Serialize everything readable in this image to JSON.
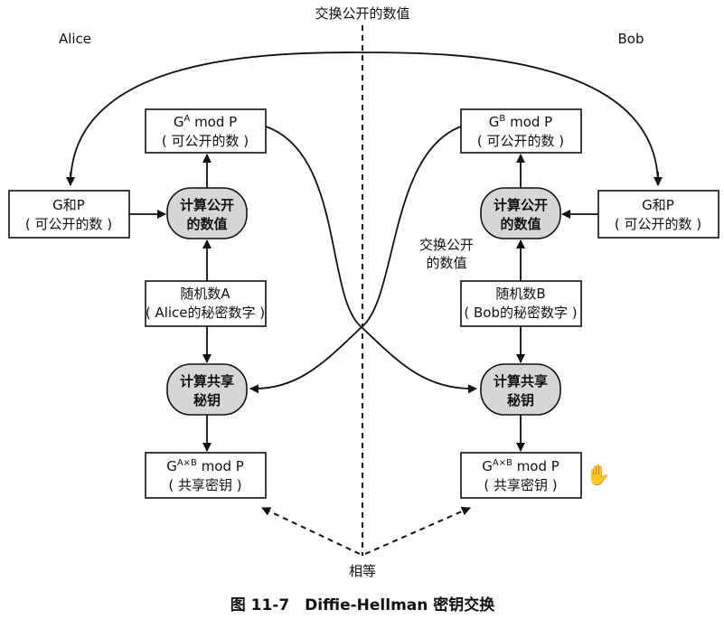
{
  "center_label": "交换公开的数值",
  "alice_label": "Alice",
  "bob_label": "Bob",
  "mid_exchange_label": [
    "交换公开",
    "的数值"
  ],
  "equal_label": "相等",
  "caption": "图 11-7　Diffie-Hellman 密钥交换",
  "alice": {
    "public_result": [
      "mod P",
      "( 可公开的数 )"
    ],
    "public_exp": "A",
    "gp": [
      "G和P",
      "( 可公开的数 )"
    ],
    "compute_public": [
      "计算公开",
      "的数值"
    ],
    "secret": [
      "随机数A",
      "( Alice的秘密数字 )"
    ],
    "compute_shared": [
      "计算共享",
      "秘钥"
    ],
    "shared_result": [
      "mod P",
      "( 共享密钥 )"
    ],
    "shared_exp": "A×B"
  },
  "bob": {
    "public_result": [
      "mod P",
      "( 可公开的数 )"
    ],
    "public_exp": "B",
    "gp": [
      "G和P",
      "( 可公开的数 )"
    ],
    "compute_public": [
      "计算公开",
      "的数值"
    ],
    "secret": [
      "随机数B",
      "( Bob的秘密数字 )"
    ],
    "compute_shared": [
      "计算共享",
      "秘钥"
    ],
    "shared_result": [
      "mod P",
      "( 共享密钥 )"
    ],
    "shared_exp": "A×B"
  },
  "base_letter": "G",
  "icons": {
    "cursor": "hand-cursor-icon"
  }
}
